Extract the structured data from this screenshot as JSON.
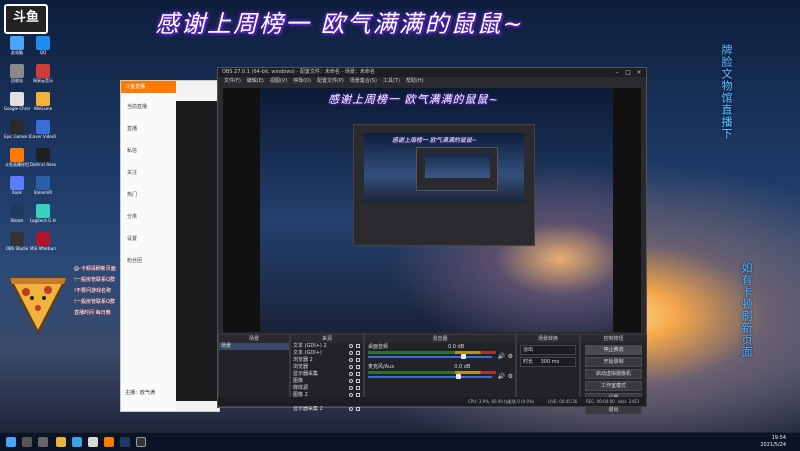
{
  "desktop": {
    "banner": "感谢上周榜一 欧气满满的鼠鼠~",
    "logo_text": "斗鱼",
    "side_text_right_top": "牌脸文物馆直播下",
    "side_text_right_bottom": "如有卡顿刷新页面",
    "overlay_lines": [
      "@-卡顿请刷新页面",
      "!一般房管联系Q群",
      "!不要问游戏名称",
      "!一般房管联系Q群",
      "直播时间 每日晚"
    ],
    "icons_left": [
      "此电脑",
      "回收站",
      "Google Chrome",
      "Epic Games Launcher",
      "斗鱼直播伴侣",
      "Kook",
      "Steam",
      "OBS Studio",
      "QQ",
      "网易云音乐",
      "WeGame",
      "Cover VideoStudio",
      "DaVinci Resolve",
      "SteamVR",
      "Logitech G HUB",
      "MSI Afterburner"
    ]
  },
  "chat_panel": {
    "header": "斗鱼直播",
    "menu": [
      "当前直播",
      "直播",
      "私信",
      "关注",
      "热门",
      "分类",
      "设置",
      "粉丝团"
    ],
    "footer_user": "主播：欧气满"
  },
  "obs": {
    "title": "OBS 27.0.1 (64-bit, windows) - 配置文件：未命名 - 场景：未命名",
    "menu": [
      "文件(F)",
      "编辑(E)",
      "视图(V)",
      "停靠(D)",
      "配置文件(P)",
      "场景集合(S)",
      "工具(T)",
      "帮助(H)"
    ],
    "preview": {
      "banner": "感谢上周榜一 欧气满满的鼠鼠~",
      "nested_banner": "感谢上周榜一 欧气满满的鼠鼠~"
    },
    "docks": {
      "scenes_title": "场景",
      "scenes": [
        "场景"
      ],
      "sources_title": "来源",
      "sources": [
        "文本 (GDI+) 2",
        "文本 (GDI+)",
        "浏览器 2",
        "浏览器",
        "显示器采集",
        "图像",
        "媒体源",
        "图像 2",
        "窗口采集",
        "显示器采集 2"
      ],
      "mixer_title": "混音器",
      "mixer": [
        {
          "name": "桌面音频",
          "db": "0.0 dB",
          "level": 0.78
        },
        {
          "name": "麦克风/Aux",
          "db": "0.0 dB",
          "level": 0.74
        }
      ],
      "transition_title": "场景转换",
      "transition_type": "淡出",
      "transition_duration_label": "时长",
      "transition_duration": "300 ms",
      "controls_title": "控制按钮",
      "controls": [
        "停止推流",
        "开始录制",
        "启动虚拟摄像机",
        "工作室模式",
        "设置",
        "退出"
      ]
    },
    "status": {
      "dropped": "丢帧 0 (0.0%)",
      "live": "LIVE: 00:45:36",
      "rec": "REC: 00:00:00",
      "cpu": "CPU: 3.9%, 60.00 fps",
      "kbps": "kb/s: 2453"
    }
  },
  "taskbar": {
    "time": "19:54",
    "date": "2021/5/24"
  },
  "colors": {
    "banner_glow": "#6b2bd8",
    "side_text": "#5fc9ff",
    "obs_bg": "#2b2a2f",
    "meter_green": "#2e7d32",
    "slider_blue": "#3a6fd8"
  }
}
